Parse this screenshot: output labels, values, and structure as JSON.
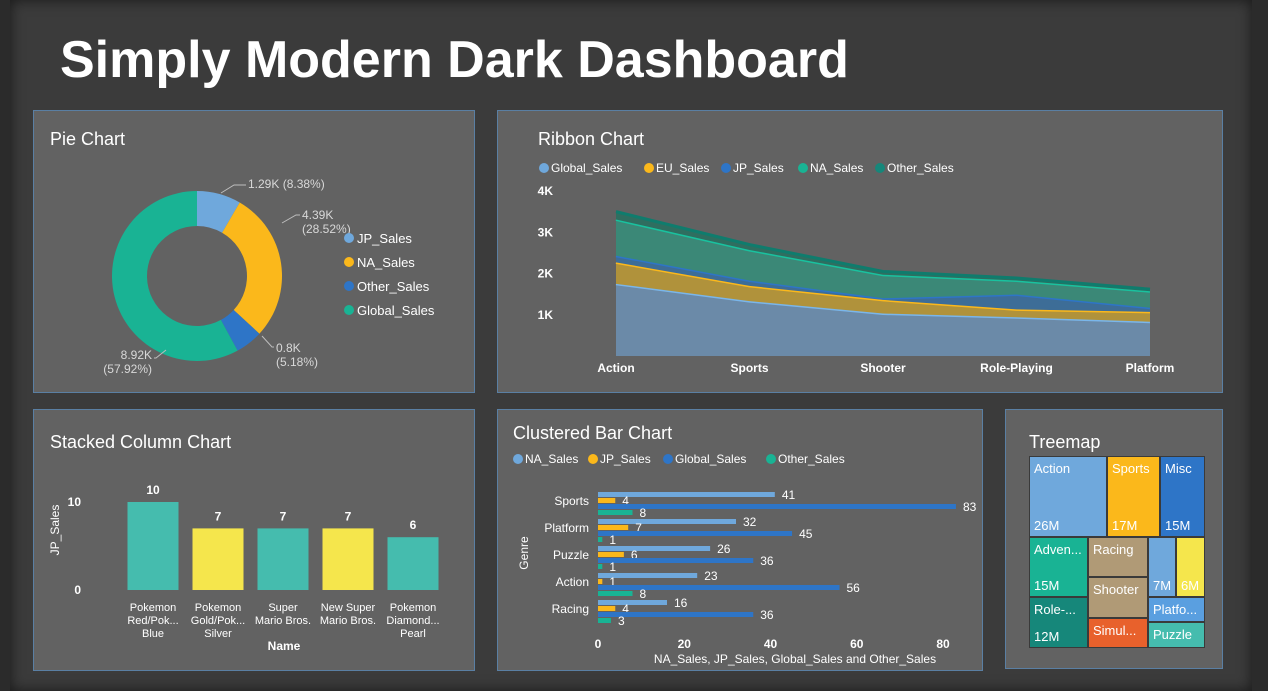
{
  "dashboard_title": "Simply Modern Dark Dashboard",
  "colors": {
    "light_blue": "#6fa8dc",
    "gold": "#fbb81b",
    "blue": "#2e75c7",
    "teal": "#19b394",
    "dark_teal": "#16877a",
    "yellow": "#f5e64c",
    "tan": "#b09a76",
    "orange": "#e8612c",
    "light_teal": "#45bcae"
  },
  "pie": {
    "title": "Pie Chart",
    "slices": [
      {
        "name": "JP_Sales",
        "value": 1290,
        "label1": "1.29K (8.38%)",
        "label2": "",
        "color": "#6fa8dc"
      },
      {
        "name": "NA_Sales",
        "value": 4390,
        "label1": "4.39K",
        "label2": "(28.52%)",
        "color": "#fbb81b"
      },
      {
        "name": "Other_Sales",
        "value": 800,
        "label1": "0.8K",
        "label2": "(5.18%)",
        "color": "#2e75c7"
      },
      {
        "name": "Global_Sales",
        "value": 8920,
        "label1": "8.92K",
        "label2": "(57.92%)",
        "color": "#19b394"
      }
    ]
  },
  "ribbon": {
    "title": "Ribbon Chart",
    "legend": [
      {
        "name": "Global_Sales",
        "color": "#6fa8dc"
      },
      {
        "name": "EU_Sales",
        "color": "#fbb81b"
      },
      {
        "name": "JP_Sales",
        "color": "#2e75c7"
      },
      {
        "name": "NA_Sales",
        "color": "#19b394"
      },
      {
        "name": "Other_Sales",
        "color": "#16877a"
      }
    ],
    "yticks": [
      "4K",
      "3K",
      "2K",
      "1K"
    ],
    "categories": [
      "Action",
      "Sports",
      "Shooter",
      "Role-Playing",
      "Platform"
    ]
  },
  "stacked": {
    "title": "Stacked Column Chart",
    "ylabel": "JP_Sales",
    "xlabel": "Name",
    "yticks": [
      "10",
      "0"
    ],
    "bars": [
      {
        "value": 10,
        "l1": "Pokemon",
        "l2": "Red/Pok...",
        "l3": "Blue",
        "color": "#45bcae"
      },
      {
        "value": 7,
        "l1": "Pokemon",
        "l2": "Gold/Pok...",
        "l3": "Silver",
        "color": "#f5e64c"
      },
      {
        "value": 7,
        "l1": "Super",
        "l2": "Mario Bros.",
        "l3": "",
        "color": "#45bcae"
      },
      {
        "value": 7,
        "l1": "New Super",
        "l2": "Mario Bros.",
        "l3": "",
        "color": "#f5e64c"
      },
      {
        "value": 6,
        "l1": "Pokemon",
        "l2": "Diamond...",
        "l3": "Pearl",
        "color": "#45bcae"
      }
    ]
  },
  "clustered": {
    "title": "Clustered Bar Chart",
    "legend": [
      {
        "name": "NA_Sales",
        "color": "#6fa8dc"
      },
      {
        "name": "JP_Sales",
        "color": "#fbb81b"
      },
      {
        "name": "Global_Sales",
        "color": "#2e75c7"
      },
      {
        "name": "Other_Sales",
        "color": "#19b394"
      }
    ],
    "ylabel": "Genre",
    "xlabel": "NA_Sales, JP_Sales, Global_Sales and Other_Sales",
    "xticks": [
      "0",
      "20",
      "40",
      "60",
      "80"
    ],
    "xmax": 80,
    "categories": [
      {
        "name": "Sports",
        "values": [
          41,
          4,
          83,
          8
        ]
      },
      {
        "name": "Platform",
        "values": [
          32,
          7,
          45,
          1
        ]
      },
      {
        "name": "Puzzle",
        "values": [
          26,
          6,
          36,
          1
        ]
      },
      {
        "name": "Action",
        "values": [
          23,
          1,
          56,
          8
        ]
      },
      {
        "name": "Racing",
        "values": [
          16,
          4,
          36,
          3
        ]
      }
    ]
  },
  "treemap": {
    "title": "Treemap",
    "cells": [
      {
        "label": "Action",
        "value": "26M",
        "color": "#6fa8dc"
      },
      {
        "label": "Sports",
        "value": "17M",
        "color": "#fbb81b"
      },
      {
        "label": "Misc",
        "value": "15M",
        "color": "#2e75c7"
      },
      {
        "label": "Adven...",
        "value": "15M",
        "color": "#19b394"
      },
      {
        "label": "Racing",
        "value": "",
        "color": "#b09a76"
      },
      {
        "label": "",
        "value": "7M",
        "color": "#6fa8dc"
      },
      {
        "label": "",
        "value": "6M",
        "color": "#f5e64c"
      },
      {
        "label": "Role-...",
        "value": "12M",
        "color": "#16877a"
      },
      {
        "label": "Shooter",
        "value": "",
        "color": "#b09a76"
      },
      {
        "label": "Platfo...",
        "value": "",
        "color": "#5a9fe0"
      },
      {
        "label": "Simul...",
        "value": "",
        "color": "#e8612c"
      },
      {
        "label": "Puzzle",
        "value": "",
        "color": "#45bcae"
      }
    ]
  },
  "chart_data": [
    {
      "type": "pie",
      "title": "Pie Chart",
      "categories": [
        "JP_Sales",
        "NA_Sales",
        "Other_Sales",
        "Global_Sales"
      ],
      "values": [
        1290,
        4390,
        800,
        8920
      ]
    },
    {
      "type": "area",
      "title": "Ribbon Chart",
      "categories": [
        "Action",
        "Sports",
        "Shooter",
        "Role-Playing",
        "Platform"
      ],
      "series": [
        {
          "name": "Global_Sales",
          "values": [
            1750,
            1330,
            1030,
            940,
            830
          ]
        },
        {
          "name": "EU_Sales",
          "values": [
            520,
            370,
            330,
            190,
            240
          ]
        },
        {
          "name": "JP_Sales",
          "values": [
            160,
            130,
            40,
            360,
            100
          ]
        },
        {
          "name": "NA_Sales",
          "values": [
            880,
            740,
            570,
            340,
            400
          ]
        },
        {
          "name": "Other_Sales",
          "values": [
            190,
            130,
            80,
            60,
            50
          ]
        }
      ],
      "ylim": [
        0,
        4000
      ]
    },
    {
      "type": "bar",
      "title": "Stacked Column Chart",
      "categories": [
        "Pokemon Red/Pokemon Blue",
        "Pokemon Gold/Pokemon Silver",
        "Super Mario Bros.",
        "New Super Mario Bros.",
        "Pokemon Diamond/Pokemon Pearl"
      ],
      "values": [
        10,
        7,
        7,
        7,
        6
      ],
      "xlabel": "Name",
      "ylabel": "JP_Sales"
    },
    {
      "type": "bar",
      "title": "Clustered Bar Chart",
      "categories": [
        "Sports",
        "Platform",
        "Puzzle",
        "Action",
        "Racing"
      ],
      "series": [
        {
          "name": "NA_Sales",
          "values": [
            41,
            32,
            26,
            23,
            16
          ]
        },
        {
          "name": "JP_Sales",
          "values": [
            4,
            7,
            6,
            1,
            4
          ]
        },
        {
          "name": "Global_Sales",
          "values": [
            83,
            45,
            36,
            56,
            36
          ]
        },
        {
          "name": "Other_Sales",
          "values": [
            8,
            1,
            1,
            8,
            3
          ]
        }
      ],
      "xlabel": "NA_Sales, JP_Sales, Global_Sales and Other_Sales",
      "ylabel": "Genre",
      "xlim": [
        0,
        80
      ]
    },
    {
      "type": "treemap",
      "title": "Treemap",
      "categories": [
        "Action",
        "Sports",
        "Misc",
        "Adventure",
        "Role-Playing"
      ],
      "values": [
        26,
        17,
        15,
        15,
        12
      ]
    }
  ]
}
